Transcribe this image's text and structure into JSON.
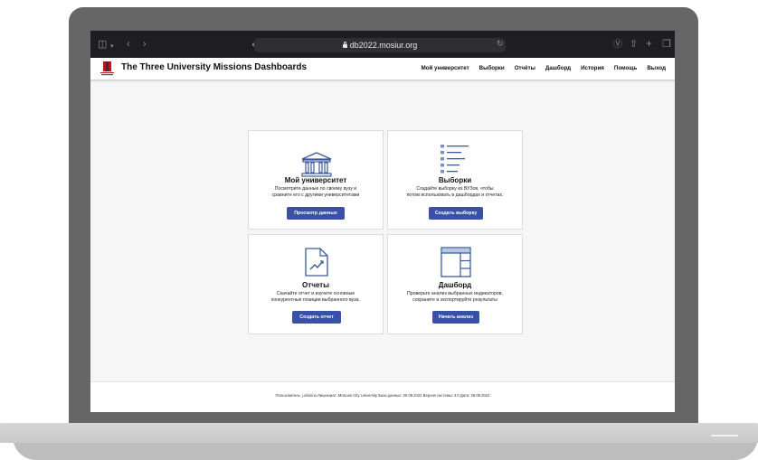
{
  "browser": {
    "url": "db2022.mosiur.org"
  },
  "header": {
    "title": "The Three University Missions Dashboards",
    "nav": [
      "Мой университет",
      "Выборки",
      "Отчёты",
      "Дашборд",
      "История",
      "Помощь",
      "Выход"
    ]
  },
  "cards": [
    {
      "title": "Мой университет",
      "desc_line1": "Посмотрите данные по своему вузу и",
      "desc_line2": "сравните его с другими университетами",
      "button": "Просмотр данных",
      "icon": "university-building-icon"
    },
    {
      "title": "Выборки",
      "desc_line1": "Создайте выборку из ВУЗов, чтобы",
      "desc_line2": "потом использовать в дашбордах и отчетах.",
      "button": "Создать выборку",
      "icon": "list-icon"
    },
    {
      "title": "Отчеты",
      "desc_line1": "Скачайте отчет и изучите основные",
      "desc_line2": "конкурентные позиции выбранного вуза.",
      "button": "Создать отчет",
      "icon": "report-chart-icon"
    },
    {
      "title": "Дашборд",
      "desc_line1": "Проверьте анализ выбранных индикаторов,",
      "desc_line2": "сохраните и экспортируйте результаты",
      "button": "Начать анализ",
      "icon": "dashboard-layout-icon"
    }
  ],
  "footer": {
    "text": "Пользователь: j.afonina   Лицензиат: Moscow City University   База данных: 30.09.2022   Версия системы: 3.0   Дата: 28.09.2022"
  },
  "colors": {
    "accent": "#3a4fa8",
    "icon_blue": "#3a5a9a",
    "header_bg": "#ffffff",
    "browser_bar": "#1e1e22"
  }
}
